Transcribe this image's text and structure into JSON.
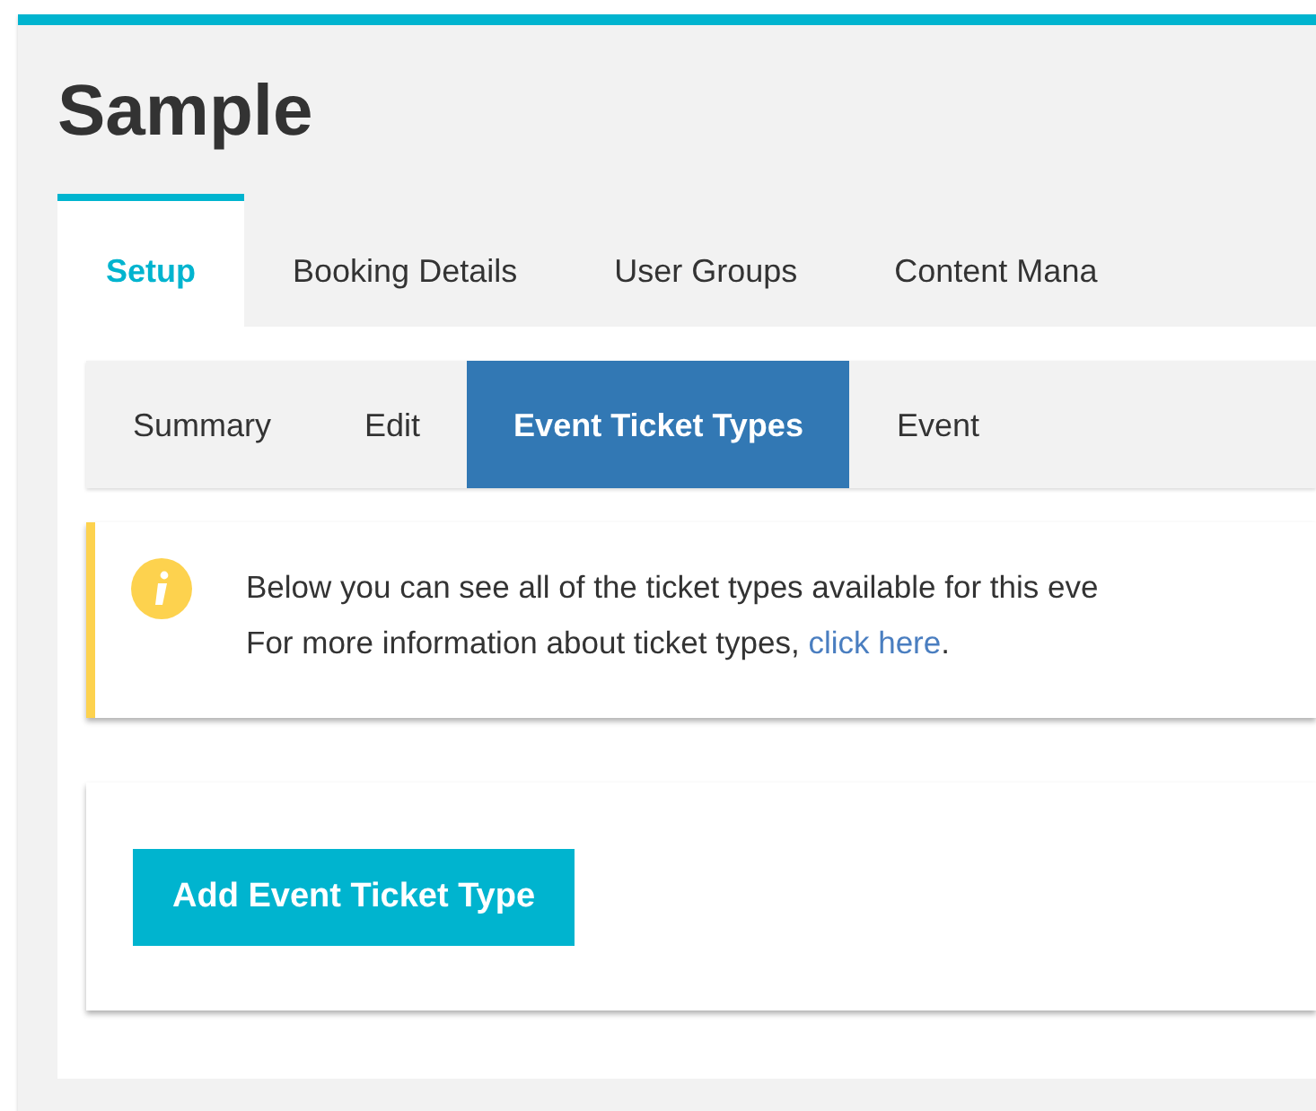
{
  "page": {
    "title": "Sample"
  },
  "tabs": [
    {
      "label": "Setup",
      "selected": true
    },
    {
      "label": "Booking Details",
      "selected": false
    },
    {
      "label": "User Groups",
      "selected": false
    },
    {
      "label": "Content Mana",
      "selected": false
    }
  ],
  "subtabs": [
    {
      "label": "Summary",
      "selected": false
    },
    {
      "label": "Edit",
      "selected": false
    },
    {
      "label": "Event Ticket Types",
      "selected": true
    },
    {
      "label": "Event",
      "selected": false
    }
  ],
  "alert": {
    "line_1": "Below you can see all of the ticket types available for this eve",
    "line_2": "For more information about ticket types, ",
    "link": "click here",
    "line_2_end": "."
  },
  "add_button": "Add Event Ticket Type"
}
